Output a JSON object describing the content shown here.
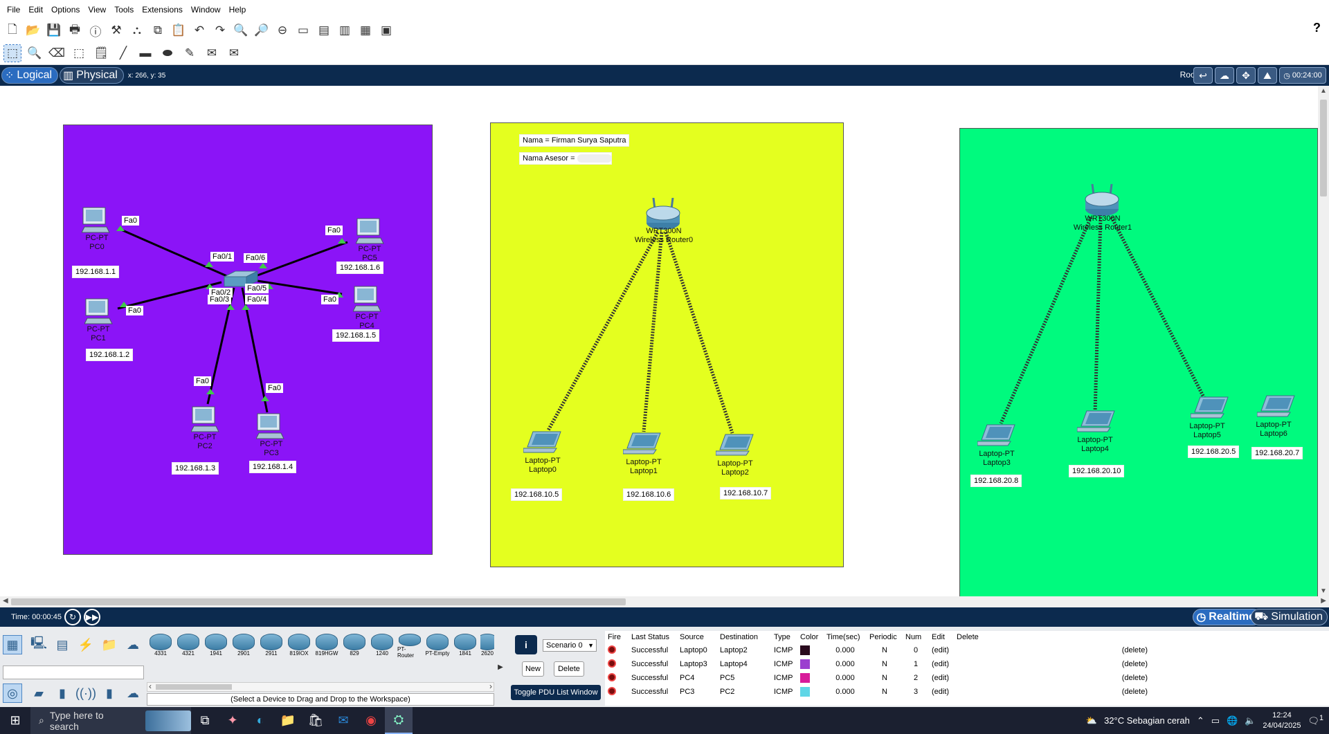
{
  "menu": [
    "File",
    "Edit",
    "Options",
    "View",
    "Tools",
    "Extensions",
    "Window",
    "Help"
  ],
  "modebar": {
    "logical": "Logical",
    "physical": "Physical",
    "coords": "x: 266, y: 35",
    "root": "Root",
    "clock": "00:24:00"
  },
  "workspace": {
    "name_label": "Nama = Firman Surya Saputra",
    "asesor_label": "Nama Asesor =",
    "zone_colors": {
      "purple": "#8b14f7",
      "yellow": "#e4ff1f",
      "green": "#00fa7e"
    },
    "devices": {
      "pc0": {
        "type": "PC-PT",
        "name": "PC0",
        "ip": "192.168.1.1",
        "port": "Fa0"
      },
      "pc1": {
        "type": "PC-PT",
        "name": "PC1",
        "ip": "192.168.1.2",
        "port": "Fa0"
      },
      "pc2": {
        "type": "PC-PT",
        "name": "PC2",
        "ip": "192.168.1.3",
        "port": "Fa0"
      },
      "pc3": {
        "type": "PC-PT",
        "name": "PC3",
        "ip": "192.168.1.4",
        "port": "Fa0"
      },
      "pc4": {
        "type": "PC-PT",
        "name": "PC4",
        "ip": "192.168.1.5",
        "port": "Fa0"
      },
      "pc5": {
        "type": "PC-PT",
        "name": "PC5",
        "ip": "192.168.1.6",
        "port": "Fa0"
      },
      "switch_ports": [
        "Fa0/1",
        "Fa0/6",
        "Fa0/2",
        "Fa0/3",
        "Fa0/5",
        "Fa0/4"
      ],
      "router0": {
        "type": "WRT300N",
        "name": "Wireless Router0"
      },
      "router1": {
        "type": "WRT300N",
        "name": "Wireless Router1"
      },
      "laptop0": {
        "type": "Laptop-PT",
        "name": "Laptop0",
        "ip": "192.168.10.5"
      },
      "laptop1": {
        "type": "Laptop-PT",
        "name": "Laptop1",
        "ip": "192.168.10.6"
      },
      "laptop2": {
        "type": "Laptop-PT",
        "name": "Laptop2",
        "ip": "192.168.10.7"
      },
      "laptop3": {
        "type": "Laptop-PT",
        "name": "Laptop3",
        "ip": "192.168.20.8"
      },
      "laptop4": {
        "type": "Laptop-PT",
        "name": "Laptop4",
        "ip": "192.168.20.10"
      },
      "laptop5": {
        "type": "Laptop-PT",
        "name": "Laptop5",
        "ip": "192.168.20.5"
      },
      "laptop6": {
        "type": "Laptop-PT",
        "name": "Laptop6",
        "ip": "192.168.20.7"
      }
    }
  },
  "status": {
    "time": "Time: 00:00:45",
    "realtime": "Realtime",
    "simulation": "Simulation"
  },
  "devices_panel": {
    "models": [
      "4331",
      "4321",
      "1941",
      "2901",
      "2911",
      "819IOX",
      "819HGW",
      "829",
      "1240",
      "PT-Router",
      "PT-Empty",
      "1841",
      "2620"
    ],
    "hint": "(Select a Device to Drag and Drop to the Workspace)"
  },
  "scenario": {
    "info": "i",
    "selected": "Scenario 0",
    "new": "New",
    "delete": "Delete",
    "toggle": "Toggle PDU List Window"
  },
  "pdu": {
    "headers": [
      "Fire",
      "Last Status",
      "Source",
      "Destination",
      "Type",
      "Color",
      "Time(sec)",
      "Periodic",
      "Num",
      "Edit",
      "Delete"
    ],
    "rows": [
      {
        "status": "Successful",
        "source": "Laptop0",
        "destination": "Laptop2",
        "type": "ICMP",
        "color": "#2a0a1e",
        "time": "0.000",
        "periodic": "N",
        "num": "0",
        "edit": "(edit)",
        "delete": "(delete)"
      },
      {
        "status": "Successful",
        "source": "Laptop3",
        "destination": "Laptop4",
        "type": "ICMP",
        "color": "#9b3fcf",
        "time": "0.000",
        "periodic": "N",
        "num": "1",
        "edit": "(edit)",
        "delete": "(delete)"
      },
      {
        "status": "Successful",
        "source": "PC4",
        "destination": "PC5",
        "type": "ICMP",
        "color": "#d81b9a",
        "time": "0.000",
        "periodic": "N",
        "num": "2",
        "edit": "(edit)",
        "delete": "(delete)"
      },
      {
        "status": "Successful",
        "source": "PC3",
        "destination": "PC2",
        "type": "ICMP",
        "color": "#5fd6e6",
        "time": "0.000",
        "periodic": "N",
        "num": "3",
        "edit": "(edit)",
        "delete": "(delete)"
      }
    ]
  },
  "taskbar": {
    "search": "Type here to search",
    "weather": "32°C  Sebagian cerah",
    "time": "12:24",
    "date": "24/04/2025",
    "notif": "1"
  }
}
